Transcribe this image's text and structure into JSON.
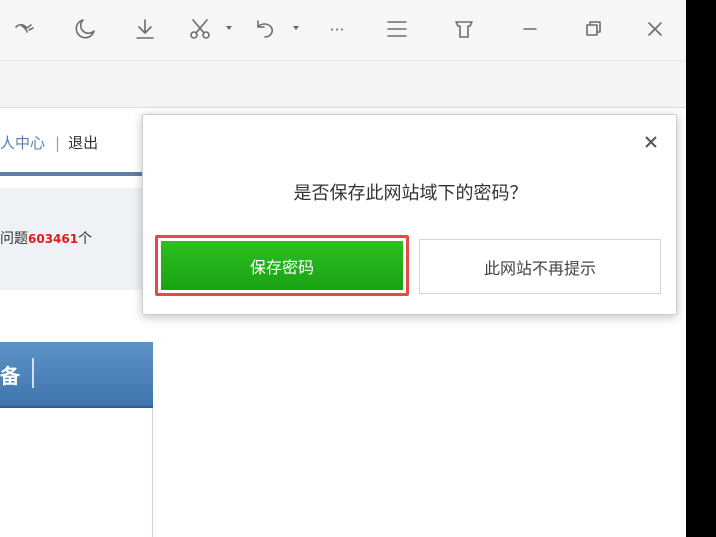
{
  "titlebar": {
    "icons": [
      "gesture-icon",
      "moon-icon",
      "download-icon",
      "scissors-icon",
      "undo-icon",
      "more-icon",
      "menu-icon",
      "skin-icon",
      "minimize-icon",
      "restore-icon",
      "close-icon"
    ],
    "more_label": "···"
  },
  "page": {
    "top_links": {
      "link1": "人中心",
      "separator": "|",
      "link2": "退出"
    },
    "info": {
      "prefix": "问题",
      "count": "603461",
      "suffix": "个"
    },
    "blue_header": {
      "text": "备"
    }
  },
  "popup": {
    "question": "是否保存此网站域下的密码？",
    "save_label": "保存密码",
    "never_label": "此网站不再提示"
  },
  "colors": {
    "save_green": "#22b21a",
    "highlight_red": "#e84848",
    "link_blue": "#5a7fa8",
    "count_red": "#e01b1b"
  }
}
